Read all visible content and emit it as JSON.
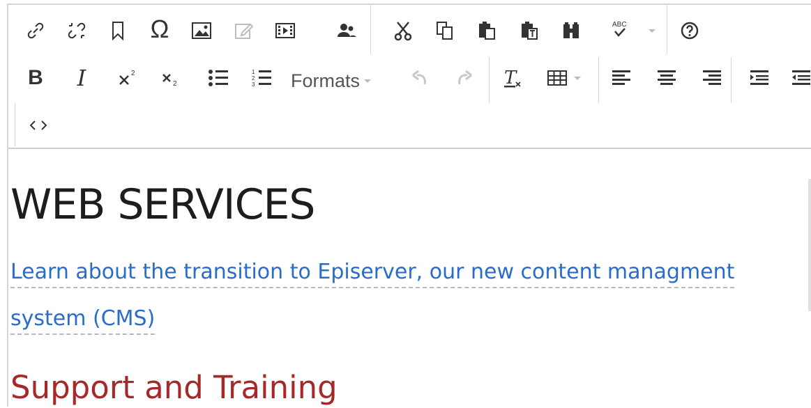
{
  "toolbar": {
    "row1": [
      "link-icon",
      "unlink-icon",
      "anchor-icon",
      "special-character-icon",
      "insert-image-icon",
      "edit-image-icon",
      "insert-media-icon",
      "user-group-icon",
      "cut-icon",
      "copy-icon",
      "paste-icon",
      "paste-text-icon",
      "find-replace-icon",
      "spellcheck-icon",
      "help-icon"
    ],
    "formats_label": "Formats",
    "source_icon": "code-icon"
  },
  "content": {
    "heading": "WEB SERVICES",
    "link_line1": "Learn about the transition to Episerver, our new content managment",
    "link_line2": "system (CMS)",
    "subheading": "Support and Training"
  },
  "colors": {
    "link": "#2a6cc9",
    "subheading": "#a8282a",
    "heading": "#1d1d1d"
  }
}
